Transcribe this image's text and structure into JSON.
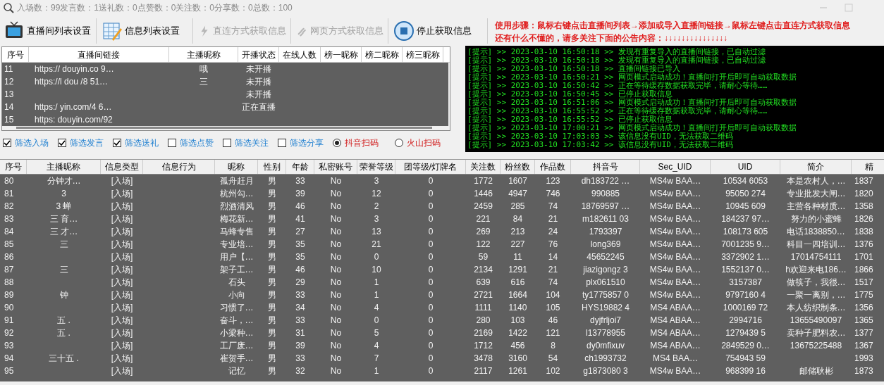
{
  "status_line": "入场数：99发言数：1送礼数：0点赞数：0关注数：0分享数：0总数：100",
  "toolbar": [
    {
      "label": "直播间列表设置",
      "disabled": false
    },
    {
      "label": "信息列表设置",
      "disabled": false
    },
    {
      "label": "直连方式获取信息",
      "disabled": true
    },
    {
      "label": "网页方式获取信息",
      "disabled": true
    },
    {
      "label": "停止获取信息",
      "disabled": false
    }
  ],
  "instructions": [
    "使用步骤：鼠标右键点击直播间列表→添加或导入直播间链接→鼠标左键点击直连方式获取信息",
    "还有什么不懂的，请多关注下面的公告内容：↓↓↓↓↓↓↓↓↓↓↓↓↓↓↓"
  ],
  "room_table": {
    "columns": [
      "序号",
      "直播间链接",
      "主播昵称",
      "开播状态",
      "在线人数",
      "榜一昵称",
      "榜二昵称",
      "榜三昵称"
    ],
    "rows": [
      {
        "no": "11",
        "link": "https:// douyin.co 9…",
        "host": "哦",
        "state": "未开播"
      },
      {
        "no": "12",
        "link": "https://l dou /8 51…",
        "host": "三",
        "state": "未开播"
      },
      {
        "no": "13",
        "state": "未开播"
      },
      {
        "no": "14",
        "link": "https:/ yin.com/4 6…",
        "state": "正在直播"
      },
      {
        "no": "15",
        "link": "https: douyin.com/92"
      }
    ]
  },
  "console": [
    "[提示] >> 2023-03-10 16:50:18 >> 发现有重复导入的直播间链接，已自动过滤",
    "[提示] >> 2023-03-10 16:50:18 >> 发现有重复导入的直播间链接，已自动过滤",
    "[提示] >> 2023-03-10 16:50:18 >> 直播间链接已导入",
    "[提示] >> 2023-03-10 16:50:21 >> 网页模式启动成功！直播间打开后即可自动获取数据",
    "[提示] >> 2023-03-10 16:50:42 >> 正在等待缓存数据获取完毕，请耐心等待……",
    "[提示] >> 2023-03-10 16:50:45 >> 已停止获取信息",
    "[提示] >> 2023-03-10 16:51:06 >> 网页模式启动成功！直播间打开后即可自动获取数据",
    "[提示] >> 2023-03-10 16:55:52 >> 正在等待缓存数据获取完毕，请耐心等待……",
    "[提示] >> 2023-03-10 16:55:52 >> 已停止获取信息",
    "[提示] >> 2023-03-10 17:00:21 >> 网页模式启动成功！直播间打开后即可自动获取数据",
    "[提示] >> 2023-03-10 17:03:03 >> 该信息没有UID，无法获取二维码",
    "[提示] >> 2023-03-10 17:03:42 >> 该信息没有UID，无法获取二维码"
  ],
  "filters": [
    {
      "kind": "checkbox",
      "label": "筛选入场",
      "checked": true
    },
    {
      "kind": "checkbox",
      "label": "筛选发言",
      "checked": true
    },
    {
      "kind": "checkbox",
      "label": "筛选送礼",
      "checked": true
    },
    {
      "kind": "checkbox",
      "label": "筛选点赞",
      "checked": false
    },
    {
      "kind": "checkbox",
      "label": "筛选关注",
      "checked": false
    },
    {
      "kind": "checkbox",
      "label": "筛选分享",
      "checked": false
    },
    {
      "kind": "radio",
      "label": "抖音扫码",
      "selected": true
    },
    {
      "kind": "radio",
      "label": "火山扫码",
      "selected": false
    }
  ],
  "info_table": {
    "columns": [
      "序号",
      "主播昵称",
      "信息类型",
      "信息行为",
      "昵称",
      "性别",
      "年龄",
      "私密账号",
      "荣誉等级",
      "团等级/灯牌名",
      "关注数",
      "粉丝数",
      "作品数",
      "抖音号",
      "Sec_UID",
      "UID",
      "简介",
      "精"
    ],
    "rows": [
      [
        "80",
        "分钟才…",
        "[入场]",
        null,
        "孤舟赶月",
        "男",
        "33",
        "No",
        "3",
        "0",
        "1772",
        "1607",
        "123",
        "dh183722 …",
        "MS4w BAA…",
        "10534 6053",
        "本是农村人，…",
        "1837"
      ],
      [
        "81",
        "3",
        "[入场]",
        null,
        "杭州勾…",
        "男",
        "39",
        "No",
        "12",
        "0",
        "1446",
        "4947",
        "746",
        "990885",
        "MS4w BAA…",
        "95050 274",
        "专业批发大闸…",
        "1820"
      ],
      [
        "82",
        "3 蝉",
        "[入场]",
        null,
        "烈酒清风",
        "男",
        "46",
        "No",
        "2",
        "0",
        "2459",
        "285",
        "74",
        "18769597 …",
        "MS4w BAA…",
        "10945 609",
        "主营各种材质…",
        "1358"
      ],
      [
        "83",
        "三 育…",
        "[入场]",
        null,
        "梅花新…",
        "男",
        "41",
        "No",
        "3",
        "0",
        "221",
        "84",
        "21",
        "m182611 03",
        "MS4w BAA…",
        "184237 97…",
        "努力的小蜜蜂",
        "1826"
      ],
      [
        "84",
        "三 才…",
        "[入场]",
        null,
        "马蜂专售",
        "男",
        "27",
        "No",
        "13",
        "0",
        "269",
        "213",
        "24",
        "1793397",
        "MS4w BAA…",
        "108173 605",
        "电话1838850…",
        "1838"
      ],
      [
        "85",
        "三",
        "[入场]",
        null,
        "专业培…",
        "男",
        "35",
        "No",
        "21",
        "0",
        "122",
        "227",
        "76",
        "long369",
        "MS4w BAA…",
        "7001235 9…",
        "科目一四培训…",
        "1376"
      ],
      [
        "86",
        null,
        "[入场]",
        null,
        "用户【…",
        "男",
        "35",
        "No",
        "0",
        "0",
        "59",
        "11",
        "14",
        "45652245",
        "MS4w BAA…",
        "3372902 1…",
        "17014754111",
        "1701"
      ],
      [
        "87",
        "三",
        "[入场]",
        null,
        "架子工…",
        "男",
        "46",
        "No",
        "10",
        "0",
        "2134",
        "1291",
        "21",
        "jiazigongz 3",
        "MS4w BAA…",
        "1552137 0…",
        "h欢迎来电186…",
        "1866"
      ],
      [
        "88",
        null,
        "[入场]",
        null,
        "石头",
        "男",
        "29",
        "No",
        "1",
        "0",
        "639",
        "616",
        "74",
        "plx061510",
        "MS4w BAA…",
        "3157387",
        "做筷子，我很…",
        "1517"
      ],
      [
        "89",
        "钟",
        "[入场]",
        null,
        "小向",
        "男",
        "33",
        "No",
        "1",
        "0",
        "2721",
        "1664",
        "104",
        "ty1775857 0",
        "MS4w BAA…",
        "9797160 4",
        "一聚一离别，…",
        "1775"
      ],
      [
        "90",
        null,
        "[入场]",
        null,
        "习惯了…",
        "男",
        "34",
        "No",
        "4",
        "0",
        "1111",
        "1140",
        "105",
        "HYS19882 4",
        "MS4 ABAA…",
        "1000169 72",
        "本人纺织制条…",
        "1356"
      ],
      [
        "91",
        "五 .",
        "[入场]",
        null,
        "奋斗，…",
        "男",
        "33",
        "No",
        "0",
        "0",
        "280",
        "103",
        "46",
        "dyjfrljoi7",
        "MS4 ABAA…",
        "2994716",
        "13655490097",
        "1365"
      ],
      [
        "92",
        "五 .",
        "[入场]",
        null,
        "小梁种…",
        "男",
        "31",
        "No",
        "5",
        "0",
        "2169",
        "1422",
        "121",
        "l13778955",
        "MS4 ABAA…",
        "1279439 5",
        "卖种子肥料农…",
        "1377"
      ],
      [
        "93",
        null,
        "[入场]",
        null,
        "工厂废…",
        "男",
        "39",
        "No",
        "4",
        "0",
        "1712",
        "456",
        "8",
        "dy0mfixuv",
        "MS4 ABAA…",
        "2849529 0…",
        "13675225488",
        "1367"
      ],
      [
        "94",
        "三十五 .",
        "[入场]",
        null,
        "崔贺手…",
        "男",
        "33",
        "No",
        "7",
        "0",
        "3478",
        "3160",
        "54",
        "ch1993732",
        "MS4 BAA…",
        "754943 59",
        null,
        "1993"
      ],
      [
        "95",
        null,
        "[入场]",
        null,
        "记忆",
        "男",
        "32",
        "No",
        "1",
        "0",
        "2117",
        "1261",
        "102",
        "g1873080 3",
        "MS4w BAA…",
        "968399 16",
        "邮储耿彬",
        "1873"
      ]
    ]
  }
}
